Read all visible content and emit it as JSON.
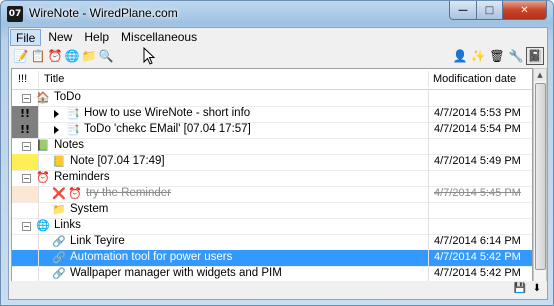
{
  "window": {
    "title": "WireNote - WiredPlane.com",
    "app_icon": "07"
  },
  "caption": {
    "minimize": "—",
    "maximize": "□",
    "close": "✕"
  },
  "menu": {
    "items": [
      "File",
      "New",
      "Help",
      "Miscellaneous"
    ],
    "active": "File"
  },
  "toolbar_left": [
    {
      "name": "new-note-icon",
      "glyph": "📝"
    },
    {
      "name": "todo-clipboard-icon",
      "glyph": "📋"
    },
    {
      "name": "alarm-clock-icon",
      "glyph": "⏰"
    },
    {
      "name": "globe-link-icon",
      "glyph": "🌐"
    },
    {
      "name": "folder-icon",
      "glyph": "📁"
    },
    {
      "name": "search-icon",
      "glyph": "🔍"
    }
  ],
  "toolbar_right": [
    {
      "name": "user-icon",
      "glyph": "👤"
    },
    {
      "name": "magic-wand-icon",
      "glyph": "✨"
    },
    {
      "name": "trash-icon",
      "glyph": "🗑"
    },
    {
      "name": "wrench-icon",
      "glyph": "🔧"
    },
    {
      "name": "notebook-icon",
      "glyph": "📓"
    }
  ],
  "columns": {
    "priority": "!!!",
    "title": "Title",
    "date": "Modification date"
  },
  "rows": [
    {
      "type": "group",
      "prio": "",
      "prio_class": "",
      "expander": "⊟",
      "icon": "🏠",
      "icon_name": "todo-group-icon",
      "title": "ToDo",
      "date": ""
    },
    {
      "type": "item",
      "prio": "!!",
      "prio_class": "p2",
      "arrow": true,
      "icon": "📑",
      "icon_name": "todo-item-icon",
      "title": "How to use WireNote - short info",
      "date": "4/7/2014 5:53 PM"
    },
    {
      "type": "item",
      "prio": "!!",
      "prio_class": "p2",
      "arrow": true,
      "icon": "📑",
      "icon_name": "todo-item-icon",
      "title": "ToDo 'chekc EMail' [07.04 17:57]",
      "date": "4/7/2014 5:54 PM"
    },
    {
      "type": "group",
      "prio": "",
      "prio_class": "",
      "expander": "⊟",
      "icon": "📗",
      "icon_name": "notes-group-icon",
      "title": "Notes",
      "date": ""
    },
    {
      "type": "item",
      "prio": "",
      "prio_class": "p1",
      "arrow": false,
      "icon": "📒",
      "icon_name": "note-icon",
      "title": "Note [07.04 17:49]",
      "date": "4/7/2014 5:49 PM"
    },
    {
      "type": "group",
      "prio": "",
      "prio_class": "",
      "expander": "⊟",
      "icon": "⏰",
      "icon_name": "reminders-group-icon",
      "title": "Reminders",
      "date": ""
    },
    {
      "type": "item",
      "prio": "",
      "prio_class": "p0",
      "arrow": false,
      "icon": "❌",
      "icon_name": "reminder-cancelled-icon",
      "icon2": "⏰",
      "title": "try the Reminder",
      "date": "4/7/2014 5:45 PM",
      "struck": true
    },
    {
      "type": "item",
      "prio": "",
      "prio_class": "",
      "arrow": false,
      "icon": "📁",
      "icon_name": "folder-icon",
      "title": "System",
      "date": ""
    },
    {
      "type": "group",
      "prio": "",
      "prio_class": "",
      "expander": "⊟",
      "icon": "🌐",
      "icon_name": "links-group-icon",
      "title": "Links",
      "date": ""
    },
    {
      "type": "item",
      "prio": "",
      "prio_class": "",
      "arrow": false,
      "icon": "🔗",
      "icon_name": "link-icon",
      "title": "Link Teyire",
      "date": "4/7/2014 6:14 PM"
    },
    {
      "type": "item",
      "prio": "",
      "prio_class": "",
      "arrow": false,
      "icon": "🔗",
      "icon_name": "link-icon",
      "title": "Automation tool for power users",
      "date": "4/7/2014 5:42 PM",
      "selected": true
    },
    {
      "type": "item",
      "prio": "",
      "prio_class": "",
      "arrow": false,
      "icon": "🔗",
      "icon_name": "link-icon",
      "title": "Wallpaper manager with widgets and PIM",
      "date": "4/7/2014 5:42 PM"
    }
  ],
  "statusbar": [
    {
      "name": "save-icon",
      "glyph": "💾"
    },
    {
      "name": "download-icon",
      "glyph": "⬇"
    }
  ],
  "scrollbar": {
    "up": "▲",
    "down": "▼"
  }
}
